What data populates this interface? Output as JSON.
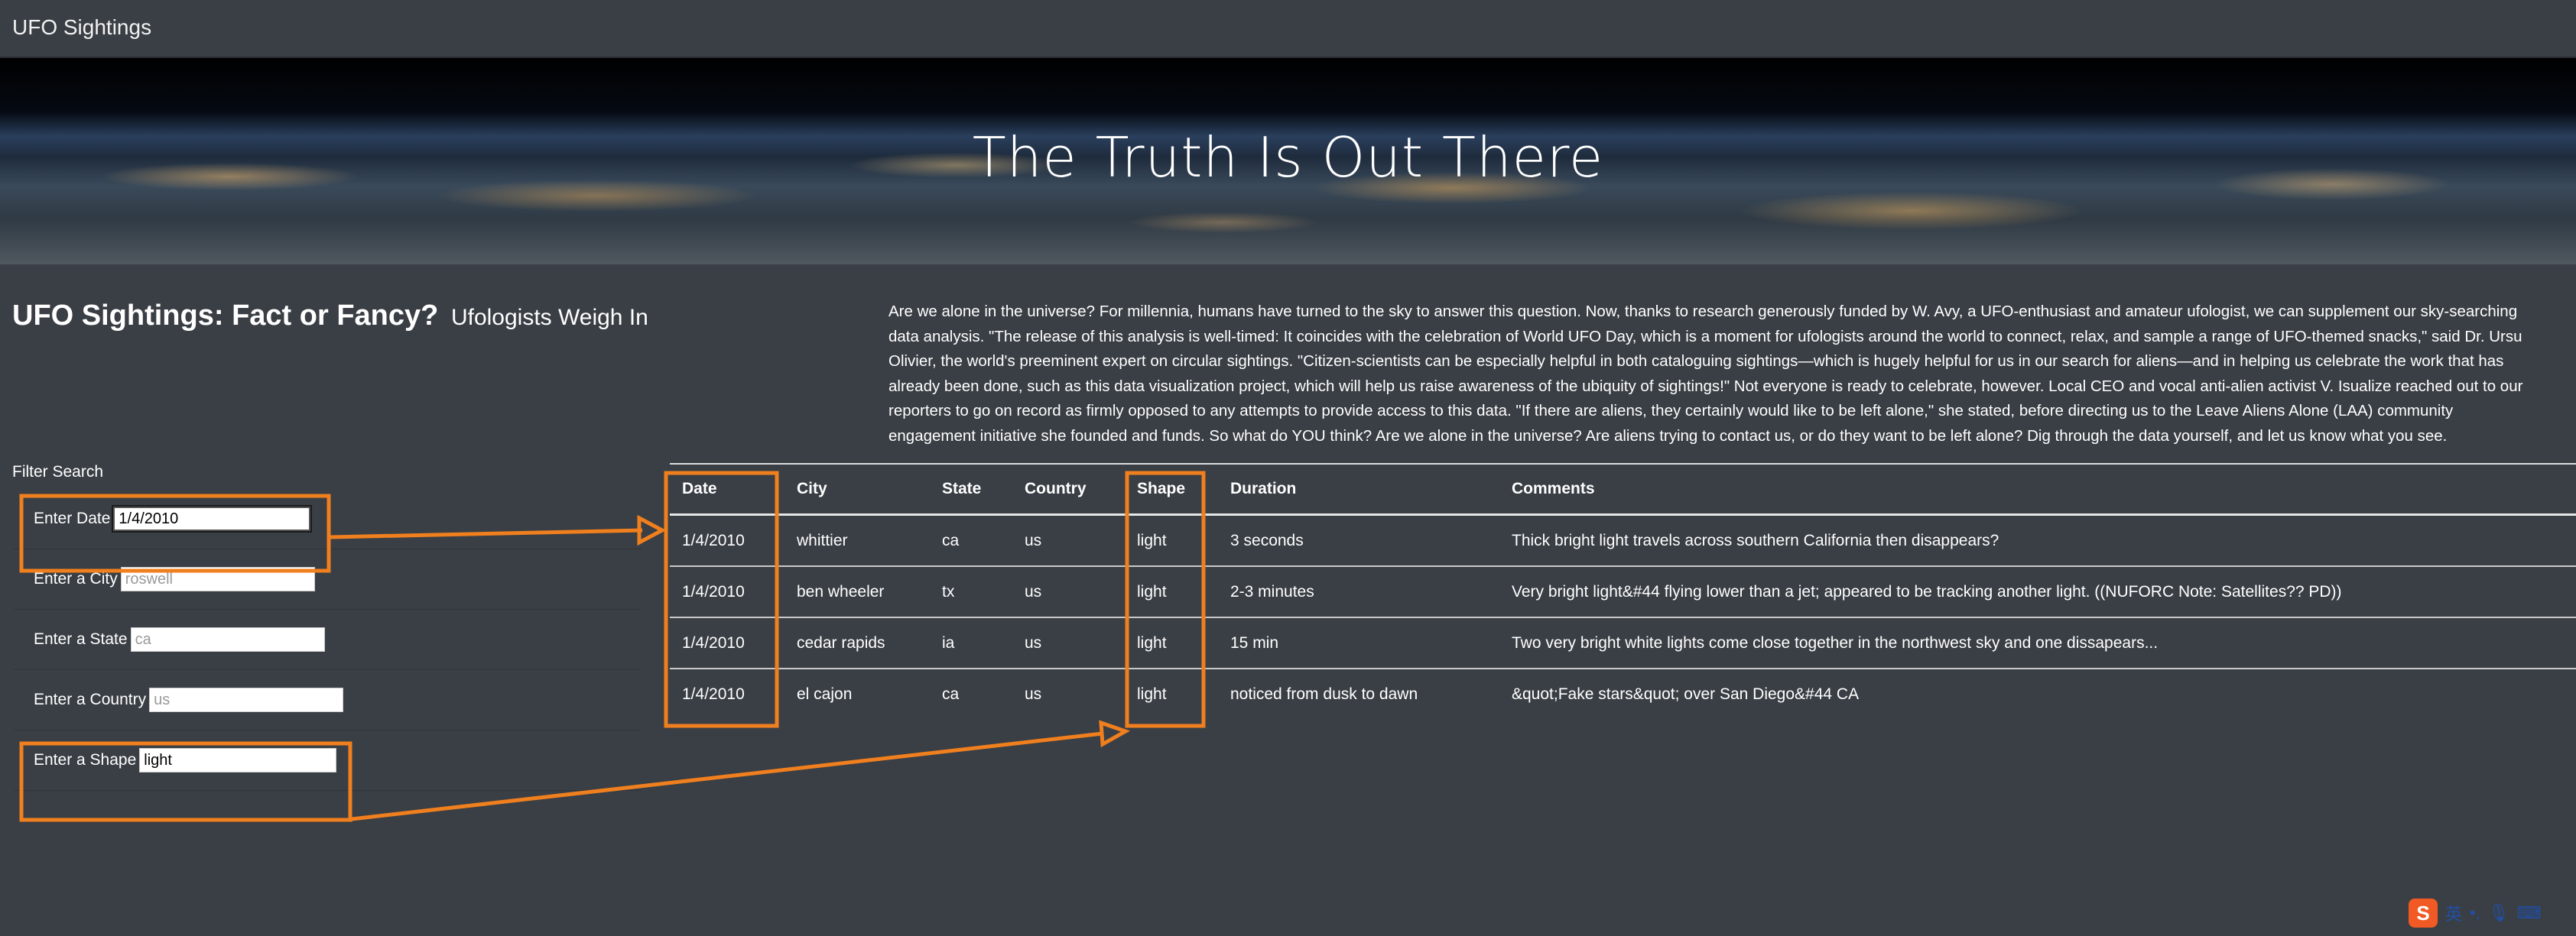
{
  "navbar": {
    "brand": "UFO Sightings"
  },
  "hero": {
    "title": "The Truth Is Out There"
  },
  "heading": {
    "title": "UFO Sightings: Fact or Fancy?",
    "subtitle": "Ufologists Weigh In"
  },
  "intro": {
    "lines": [
      "Are we alone in the universe? For millennia, humans have turned to the sky to answer this question. Now, thanks to research generously funded by W. Avy, a UFO-enthusiast and amateur ufologist, we can supplement our sky-searching",
      "data analysis. \"The release of this analysis is well-timed: It coincides with the celebration of World UFO Day, which is a moment for ufologists around the world to connect, relax, and sample a range of UFO-themed snacks,\" said Dr. Ursu",
      "Olivier, the world's preeminent expert on circular sightings. \"Citizen-scientists can be especially helpful in both cataloguing sightings—which is hugely helpful for us in our search for aliens—and in helping us celebrate the work that has",
      "already been done, such as this data visualization project, which will help us raise awareness of the ubiquity of sightings!\" Not everyone is ready to celebrate, however. Local CEO and vocal anti-alien activist V. Isualize reached out to our",
      "reporters to go on record as firmly opposed to any attempts to provide access to this data. \"If there are aliens, they certainly would like to be left alone,\" she stated, before directing us to the Leave Aliens Alone (LAA) community",
      "engagement initiative she founded and funds. So what do YOU think? Are we alone in the universe? Are aliens trying to contact us, or do they want to be left alone? Dig through the data yourself, and let us know what you see."
    ]
  },
  "filters": {
    "title": "Filter Search",
    "date": {
      "label": "Enter Date",
      "value": "1/4/2010",
      "placeholder": ""
    },
    "city": {
      "label": "Enter a City",
      "value": "",
      "placeholder": "roswell"
    },
    "state": {
      "label": "Enter a State",
      "value": "",
      "placeholder": "ca"
    },
    "country": {
      "label": "Enter a Country",
      "value": "",
      "placeholder": "us"
    },
    "shape": {
      "label": "Enter a Shape",
      "value": "light",
      "placeholder": ""
    }
  },
  "table": {
    "headers": [
      "Date",
      "City",
      "State",
      "Country",
      "Shape",
      "Duration",
      "Comments"
    ],
    "rows": [
      [
        "1/4/2010",
        "whittier",
        "ca",
        "us",
        "light",
        "3 seconds",
        "Thick bright light travels across southern California then disappears?"
      ],
      [
        "1/4/2010",
        "ben wheeler",
        "tx",
        "us",
        "light",
        "2-3 minutes",
        "Very bright light&#44 flying lower than a jet; appeared to be tracking another light. ((NUFORC Note: Satellites?? PD))"
      ],
      [
        "1/4/2010",
        "cedar rapids",
        "ia",
        "us",
        "light",
        "15 min",
        "Two very bright white lights come close together in the northwest sky and one dissapears..."
      ],
      [
        "1/4/2010",
        "el cajon",
        "ca",
        "us",
        "light",
        "noticed from dusk to dawn",
        "&quot;Fake stars&quot; over San Diego&#44 CA"
      ]
    ]
  },
  "ime": {
    "mode": "英"
  },
  "colors": {
    "annotation": "#f07f1e",
    "background": "#3a3f45"
  }
}
